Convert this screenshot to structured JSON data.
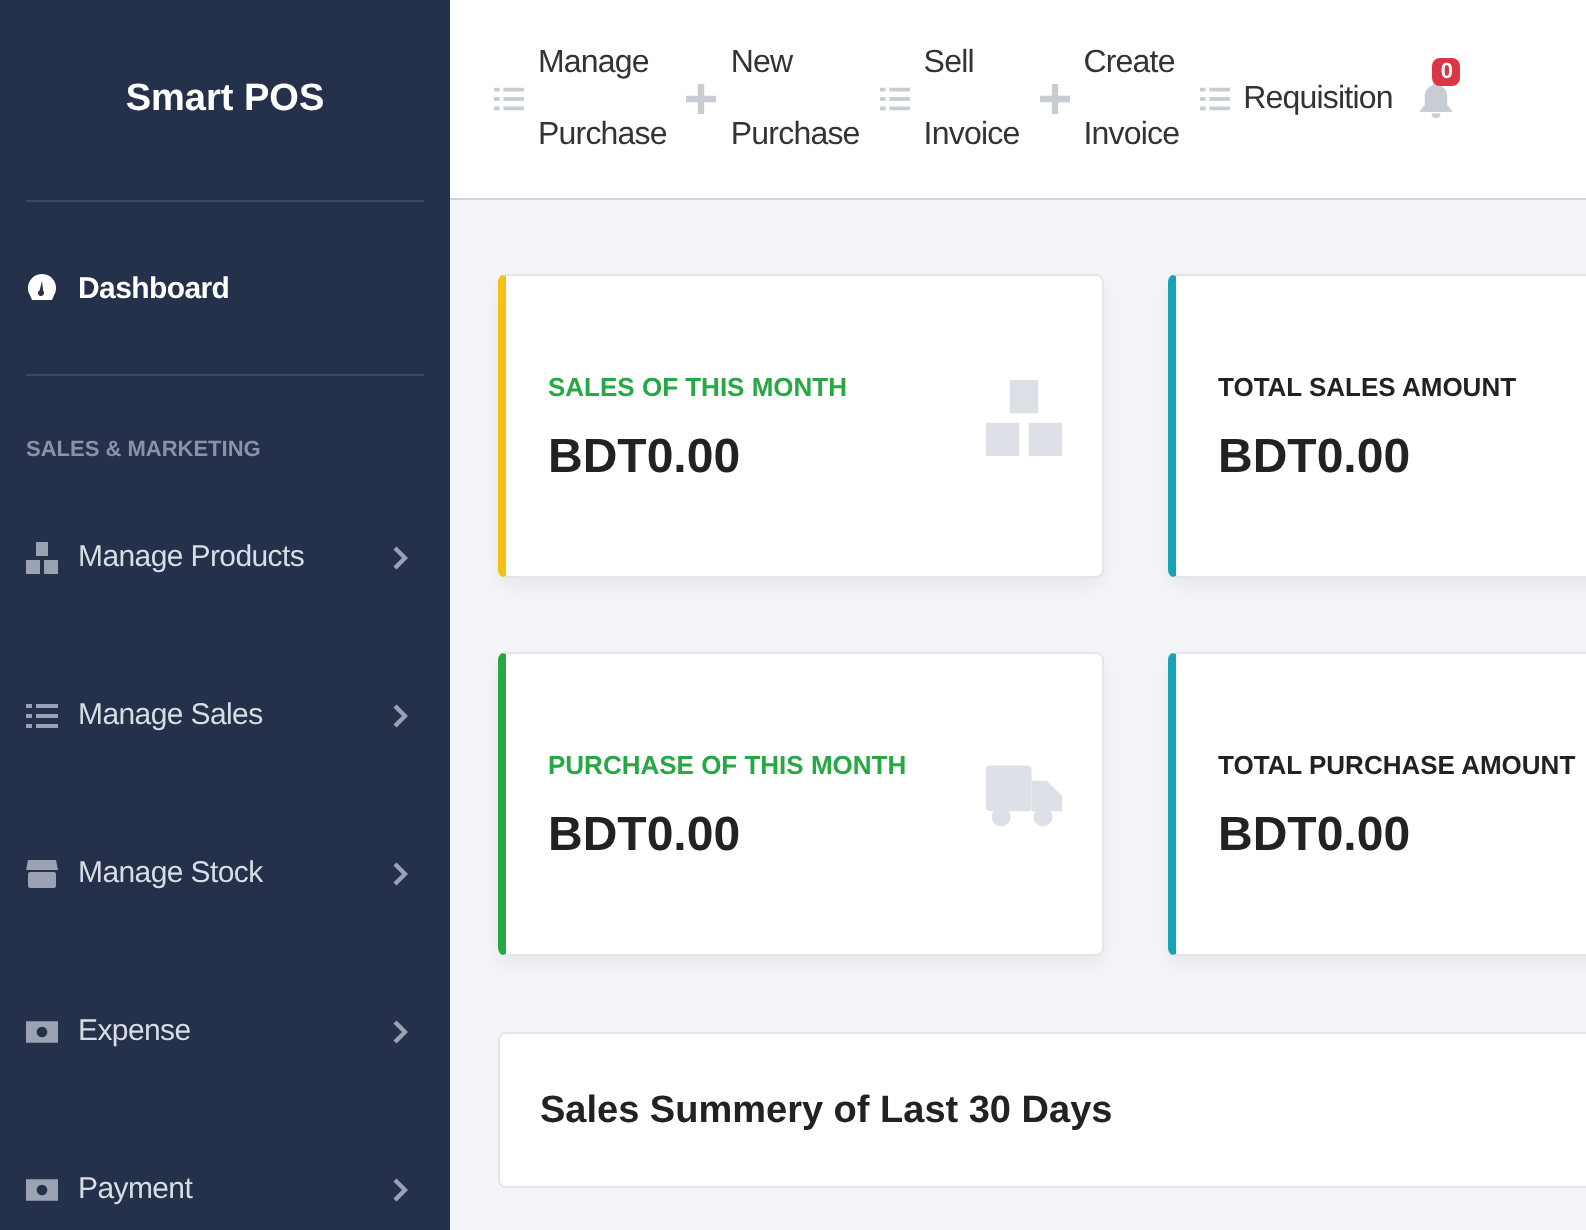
{
  "brand": "Smart POS",
  "sidebar": {
    "items": [
      {
        "label": "Dashboard",
        "kind": "gauge",
        "selected": true,
        "arrow": false
      },
      {
        "label": "Manage Products",
        "kind": "boxes",
        "selected": false,
        "arrow": true
      },
      {
        "label": "Manage Sales",
        "kind": "list",
        "selected": false,
        "arrow": true
      },
      {
        "label": "Manage Stock",
        "kind": "store",
        "selected": false,
        "arrow": true
      },
      {
        "label": "Expense",
        "kind": "money",
        "selected": false,
        "arrow": true
      },
      {
        "label": "Payment",
        "kind": "money",
        "selected": false,
        "arrow": true
      }
    ],
    "section": "SALES & MARKETING"
  },
  "topnav": [
    {
      "label": "Manage Purchase",
      "kind": "list"
    },
    {
      "label": "New Purchase",
      "kind": "plus"
    },
    {
      "label": "Sell Invoice",
      "kind": "list"
    },
    {
      "label": "Create Invoice",
      "kind": "plus"
    },
    {
      "label": "Requisition",
      "kind": "list"
    }
  ],
  "notifications": {
    "count": "0"
  },
  "cards": [
    {
      "title": "SALES OF THIS MONTH",
      "value": "BDT0.00",
      "color": "#f5c211",
      "kind": "boxes"
    },
    {
      "title": "TOTAL SALES AMOUNT",
      "value": "BDT0.00",
      "color": "#17a2b8",
      "kind": "plain"
    },
    {
      "title": "PURCHASE OF THIS MONTH",
      "value": "BDT0.00",
      "color": "#28a745",
      "kind": "truck"
    },
    {
      "title": "TOTAL PURCHASE AMOUNT",
      "value": "BDT0.00",
      "color": "#17a2b8",
      "kind": "plain"
    }
  ],
  "panel": {
    "title": "Sales Summery of Last 30 Days"
  }
}
